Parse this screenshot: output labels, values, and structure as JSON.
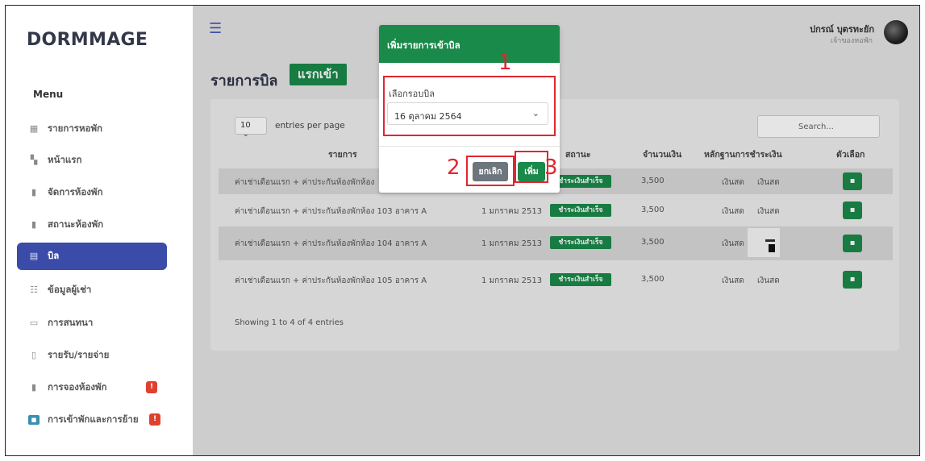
{
  "app": {
    "brand": "DORMMAGE"
  },
  "sidebar": {
    "menu_title": "Menu",
    "items": [
      {
        "label": "รายการหอพัก",
        "icon": "grid-icon"
      },
      {
        "label": "หน้าแรก",
        "icon": "dashboard-icon"
      },
      {
        "label": "จัดการห้องพัก",
        "icon": "building-icon"
      },
      {
        "label": "สถานะห้องพัก",
        "icon": "building-status-icon"
      },
      {
        "label": "บิล",
        "icon": "bill-icon",
        "active": true
      },
      {
        "label": "ข้อมูลผู้เช่า",
        "icon": "users-icon"
      },
      {
        "label": "การสนทนา",
        "icon": "chat-icon"
      },
      {
        "label": "รายรับ/รายจ่าย",
        "icon": "wallet-icon"
      },
      {
        "label": "การจองห้องพัก",
        "icon": "booking-icon",
        "badge": "!"
      },
      {
        "label": "การเข้าพักและการย้าย",
        "icon": "move-icon",
        "badge": "!"
      }
    ]
  },
  "header": {
    "user_name": "ปกรณ์ บุตรทะยัก",
    "user_role": "เจ้าของหอพัก"
  },
  "page": {
    "title": "รายการบิล",
    "tag": "แรกเข้า"
  },
  "table": {
    "per_page": "10",
    "per_page_label": "entries per page",
    "search_placeholder": "Search...",
    "columns": [
      "รายการ",
      "สถานะ",
      "จำนวนเงิน",
      "หลักฐานการชำระเงิน",
      "ตัวเลือก"
    ],
    "rows": [
      {
        "item": "ค่าเช่าเดือนแรก + ค่าประกันห้องพักห้อง",
        "date": "",
        "status": "ชำระเงินสำเร็จ",
        "amount": "3,500",
        "proof1": "เงินสด",
        "proof2": "เงินสด"
      },
      {
        "item": "ค่าเช่าเดือนแรก + ค่าประกันห้องพักห้อง 103 อาคาร A",
        "date": "1 มกราคม 2513",
        "status": "ชำระเงินสำเร็จ",
        "amount": "3,500",
        "proof1": "เงินสด",
        "proof2": "เงินสด"
      },
      {
        "item": "ค่าเช่าเดือนแรก + ค่าประกันห้องพักห้อง 104 อาคาร A",
        "date": "1 มกราคม 2513",
        "status": "ชำระเงินสำเร็จ",
        "amount": "3,500",
        "proof1": "เงินสด",
        "proof2": ""
      },
      {
        "item": "ค่าเช่าเดือนแรก + ค่าประกันห้องพักห้อง 105 อาคาร A",
        "date": "1 มกราคม 2513",
        "status": "ชำระเงินสำเร็จ",
        "amount": "3,500",
        "proof1": "เงินสด",
        "proof2": "เงินสด"
      }
    ],
    "showing": "Showing 1 to 4 of 4 entries"
  },
  "modal": {
    "title": "เพิ่มรายการเข้าบิล",
    "field_label": "เลือกรอบบิล",
    "selected": "16 ตุลาคม 2564",
    "cancel_label": "ยกเลิก",
    "add_label": "เพิ่ม"
  },
  "annotations": [
    "1",
    "2",
    "3"
  ],
  "colors": {
    "accent_green": "#1a8a4a",
    "active_blue": "#3b4ba8",
    "annotation_red": "#e0262f",
    "badge_red": "#e0412f"
  }
}
